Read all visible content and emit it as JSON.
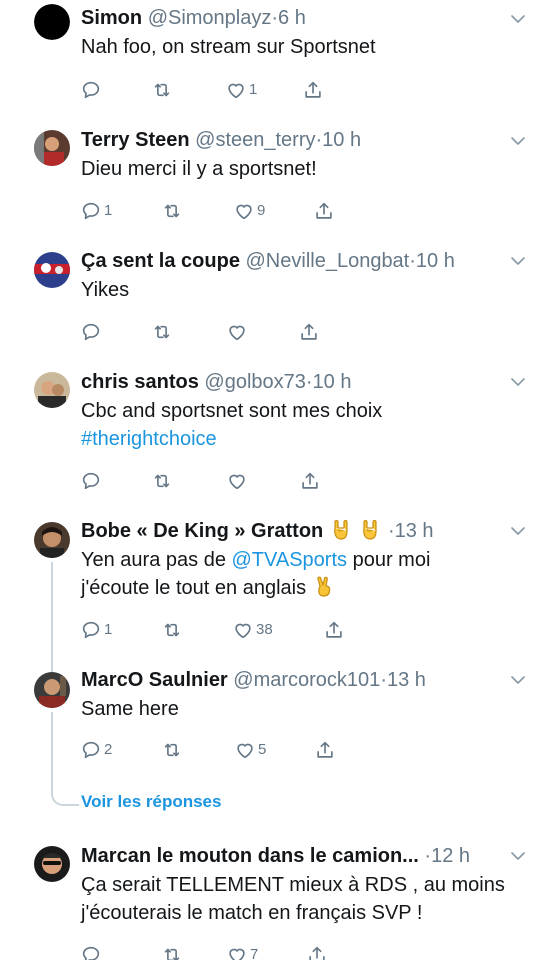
{
  "tweets": [
    {
      "name": "Simon",
      "handle": "@Simonplayz",
      "dot": "·",
      "time": "6 h",
      "text": "Nah foo, on stream sur Sportsnet",
      "replies": "",
      "likes": "1",
      "avatar_color": "#000000"
    },
    {
      "name": "Terry Steen",
      "handle": "@steen_terry",
      "dot": "·",
      "time": "10 h",
      "text": "Dieu merci il y a sportsnet!",
      "replies": "1",
      "likes": "9",
      "avatar_color": "#6b4a3a"
    },
    {
      "name": "Ça sent la coupe",
      "handle": "@Neville_Longbat",
      "dot": "·",
      "time": "10 h",
      "text": "Yikes",
      "replies": "",
      "likes": "",
      "avatar_color": "#2d3f8c"
    },
    {
      "name": "chris santos",
      "handle": "@golbox73",
      "dot": "·",
      "time": "10 h",
      "text": "Cbc and sportsnet sont mes choix",
      "hashtag": "#therightchoice",
      "replies": "",
      "likes": "",
      "avatar_color": "#8a7a6a"
    },
    {
      "name": "Bobe « De King » Gratton",
      "dot": "·",
      "time": "13 h",
      "text_a": "Yen aura pas de ",
      "mention": "@TVASports",
      "text_b": " pour moi",
      "text_c": "j'écoute le tout en anglais",
      "replies": "1",
      "likes": "38",
      "avatar_color": "#3a2a20"
    },
    {
      "name": "MarcO Saulnier",
      "handle": "@marcorock101",
      "dot": "·",
      "time": "13 h",
      "text": "Same here",
      "replies": "2",
      "likes": "5",
      "avatar_color": "#5a4a3a"
    },
    {
      "name": "Marcan le mouton dans le camion...",
      "dot": "·",
      "time": "12 h",
      "text": "Ça serait TELLEMENT mieux à RDS , au moins j'écouterais le match en français SVP !",
      "replies": "",
      "likes": "7",
      "avatar_color": "#2a2a2a"
    }
  ],
  "see_replies_label": "Voir les réponses",
  "colors": {
    "link": "#1b95e0",
    "muted": "#657786",
    "text": "#14171a",
    "thread": "#ccd6dd"
  },
  "icons": [
    "reply-icon",
    "retweet-icon",
    "like-icon",
    "share-icon",
    "chevron-down-icon",
    "rock-on-emoji",
    "victory-hand-emoji"
  ]
}
